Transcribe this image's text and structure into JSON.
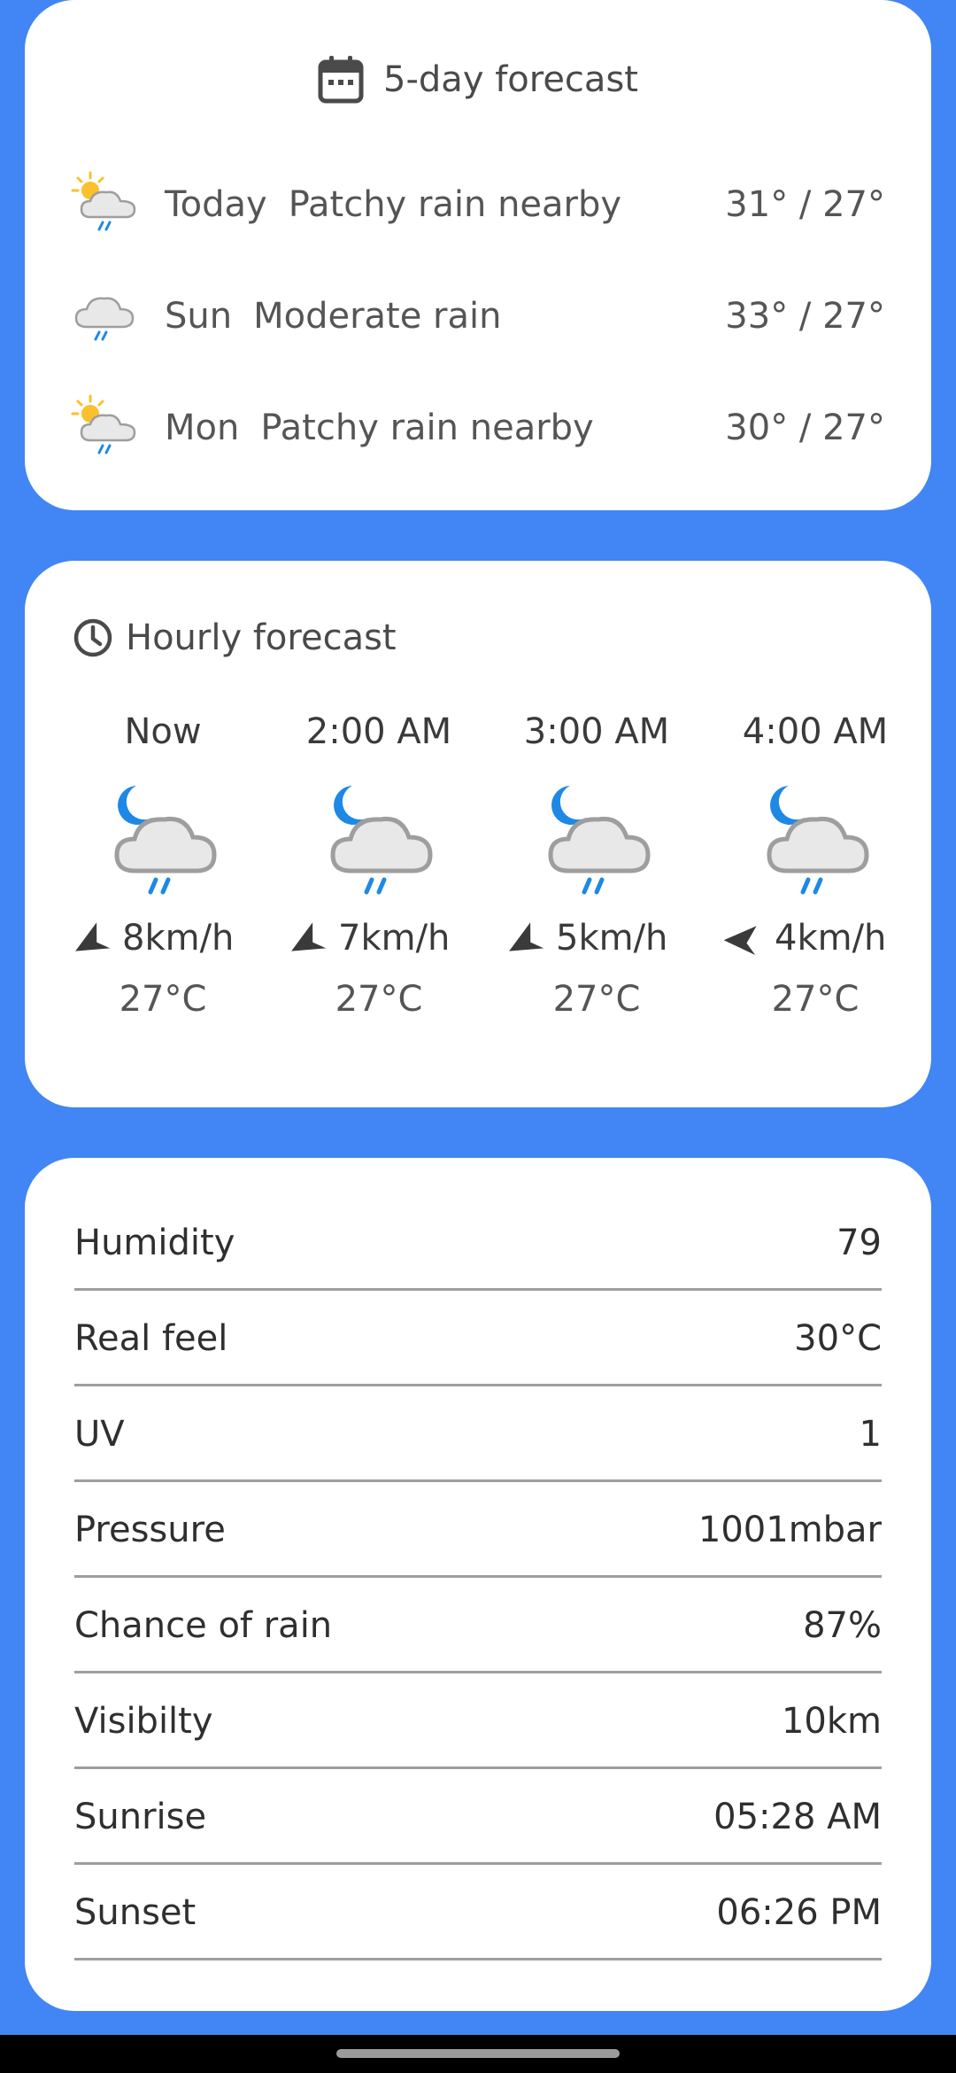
{
  "daily": {
    "title": "5-day forecast",
    "icon": "calendar-icon",
    "days": [
      {
        "day": "Today",
        "condition": "Patchy rain nearby",
        "temps": "31° / 27°",
        "icon": "sun-cloud-rain-icon"
      },
      {
        "day": "Sun",
        "condition": "Moderate rain",
        "temps": "33° / 27°",
        "icon": "cloud-rain-icon"
      },
      {
        "day": "Mon",
        "condition": "Patchy rain nearby",
        "temps": "30° / 27°",
        "icon": "sun-cloud-rain-icon"
      }
    ]
  },
  "hourly": {
    "title": "Hourly forecast",
    "icon": "clock-icon",
    "hours": [
      {
        "time": "Now",
        "wind": "8km/h",
        "temp": "27°C",
        "icon": "moon-cloud-rain-icon"
      },
      {
        "time": "2:00 AM",
        "wind": "7km/h",
        "temp": "27°C",
        "icon": "moon-cloud-rain-icon"
      },
      {
        "time": "3:00 AM",
        "wind": "5km/h",
        "temp": "27°C",
        "icon": "moon-cloud-rain-icon"
      },
      {
        "time": "4:00 AM",
        "wind": "4km/h",
        "temp": "27°C",
        "icon": "moon-cloud-rain-icon"
      }
    ]
  },
  "details": [
    {
      "label": "Humidity",
      "value": "79"
    },
    {
      "label": "Real feel",
      "value": "30°C"
    },
    {
      "label": "UV",
      "value": "1"
    },
    {
      "label": "Pressure",
      "value": "1001mbar"
    },
    {
      "label": "Chance of rain",
      "value": "87%"
    },
    {
      "label": "Visibilty",
      "value": "10km"
    },
    {
      "label": "Sunrise",
      "value": "05:28 AM"
    },
    {
      "label": "Sunset",
      "value": "06:26 PM"
    }
  ],
  "colors": {
    "background": "#4285f4",
    "card": "#ffffff",
    "moon": "#1e88e5",
    "sun": "#fbc02d",
    "rain": "#1e88e5",
    "divider": "#9e9e9e"
  }
}
